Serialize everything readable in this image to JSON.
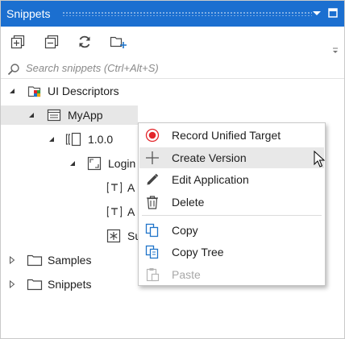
{
  "panel": {
    "title": "Snippets",
    "title_bar_icons": [
      "chevron-down-icon",
      "maximize-icon"
    ],
    "accent_color": "#1b6fd0"
  },
  "toolbar": {
    "buttons": [
      "expand-all-icon",
      "collapse-all-icon",
      "refresh-icon",
      "add-folder-icon"
    ]
  },
  "search": {
    "placeholder": "Search snippets (Ctrl+Alt+S)"
  },
  "tree": {
    "ui_descriptors": "UI Descriptors",
    "myapp": "MyApp",
    "version": "1.0.0",
    "login": "Login",
    "child1": "A",
    "child2": "A",
    "child3": "Su",
    "samples": "Samples",
    "snippets": "Snippets"
  },
  "context_menu": {
    "items": [
      {
        "label": "Record Unified Target",
        "icon": "record-icon"
      },
      {
        "label": "Create Version",
        "icon": "plus-icon"
      },
      {
        "label": "Edit Application",
        "icon": "pencil-icon"
      },
      {
        "label": "Delete",
        "icon": "trash-icon"
      },
      {
        "label": "Copy",
        "icon": "copy-icon"
      },
      {
        "label": "Copy Tree",
        "icon": "copy-tree-icon"
      },
      {
        "label": "Paste",
        "icon": "paste-icon"
      }
    ],
    "hovered_item": "Create Version",
    "disabled_item": "Paste"
  },
  "colors": {
    "record": "#e3262b",
    "copy_icon": "#1f74c9",
    "selection": "#e7e7e7"
  }
}
